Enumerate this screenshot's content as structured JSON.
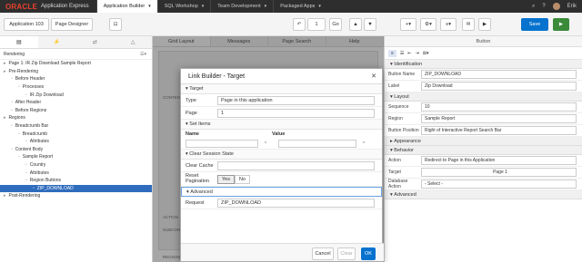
{
  "topbar": {
    "logo": "ORACLE",
    "product": "Application Express",
    "tabs": [
      {
        "label": "Application Builder",
        "active": true
      },
      {
        "label": "SQL Workshop"
      },
      {
        "label": "Team Development"
      },
      {
        "label": "Packaged Apps"
      }
    ],
    "user": "Erik"
  },
  "toolbar": {
    "app_breadcrumb": "Application 103",
    "page_breadcrumb": "Page Designer",
    "page_number": "1",
    "save_label": "Save",
    "accent": "#0572ce"
  },
  "left": {
    "heading": "Rendering",
    "tree": [
      {
        "label": "Page 1: IR Zip Download Sample Report",
        "level": 0
      },
      {
        "label": "Pre-Rendering",
        "level": 0
      },
      {
        "label": "Before Header",
        "level": 1
      },
      {
        "label": "Processes",
        "level": 2
      },
      {
        "label": "IR Zip Download",
        "level": 3
      },
      {
        "label": "After Header",
        "level": 1
      },
      {
        "label": "Before Regions",
        "level": 1
      },
      {
        "label": "Regions",
        "level": 0
      },
      {
        "label": "Breadcrumb Bar",
        "level": 1
      },
      {
        "label": "Breadcrumb",
        "level": 2
      },
      {
        "label": "Attributes",
        "level": 3
      },
      {
        "label": "Content Body",
        "level": 1
      },
      {
        "label": "Sample Report",
        "level": 2
      },
      {
        "label": "Country",
        "level": 3
      },
      {
        "label": "Attributes",
        "level": 3
      },
      {
        "label": "Region Buttons",
        "level": 3
      },
      {
        "label": "ZIP_DOWNLOAD",
        "level": 4,
        "selected": true
      },
      {
        "label": "Post-Rendering",
        "level": 0
      }
    ]
  },
  "center": {
    "tabs": [
      "Grid Layout",
      "Messages",
      "Page Search",
      "Help"
    ],
    "region_labels": [
      "CONTENT",
      "ACTION",
      "SUBCONT",
      "REGIONS"
    ]
  },
  "right": {
    "tab": "Button",
    "sections": {
      "identification": "Identification",
      "layout": "Layout",
      "appearance": "Appearance",
      "behavior": "Behavior",
      "advanced": "Advanced"
    },
    "props": {
      "button_name_label": "Button Name",
      "button_name": "ZIP_DOWNLOAD",
      "label_label": "Label",
      "label": "Zip Download",
      "sequence_label": "Sequence",
      "sequence": "10",
      "region_label": "Region",
      "region": "Sample Report",
      "button_position_label": "Button Position",
      "button_position": "Right of Interactive Report Search Bar",
      "action_label": "Action",
      "action": "Redirect to Page in this Application",
      "target_label": "Target",
      "target": "Page 1",
      "db_action_label": "Database Action",
      "db_action": "- Select -"
    }
  },
  "dialog": {
    "title": "Link Builder - Target",
    "sections": {
      "target": "Target",
      "set_items": "Set Items",
      "clear_session": "Clear Session State",
      "advanced": "Advanced"
    },
    "type_label": "Type",
    "type_value": "Page in this application",
    "page_label": "Page",
    "page_value": "1",
    "name_header": "Name",
    "value_header": "Value",
    "clear_cache_label": "Clear Cache",
    "reset_pagination_label": "Reset Pagination",
    "yes": "Yes",
    "no": "No",
    "request_label": "Request",
    "request_value": "ZIP_DOWNLOAD",
    "cancel": "Cancel",
    "clear": "Clear",
    "ok": "OK"
  }
}
